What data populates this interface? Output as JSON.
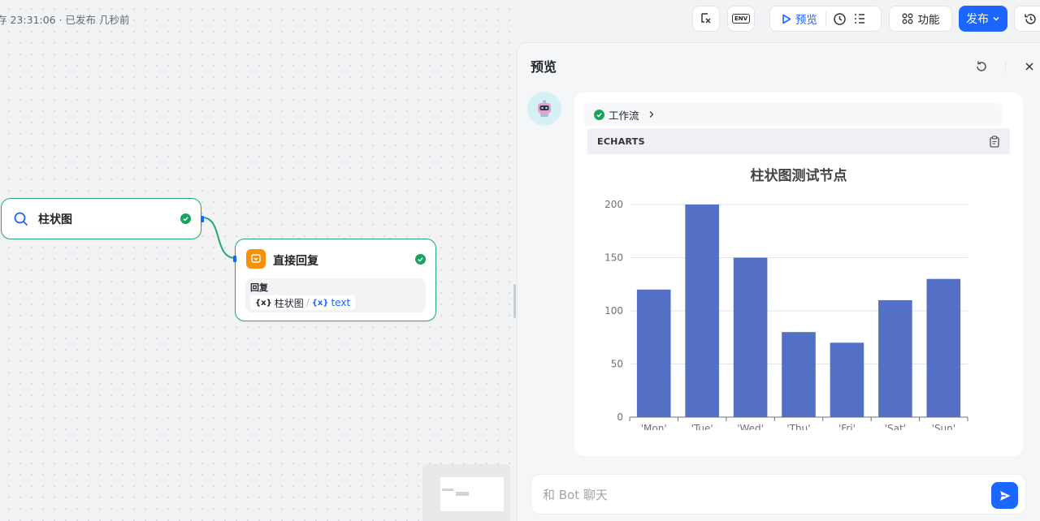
{
  "header": {
    "save_status": "存 23:31:06 · 已发布 几秒前"
  },
  "toolbar": {
    "preview_label": "预览",
    "features_label": "功能",
    "publish_label": "发布",
    "env_label": "ENV"
  },
  "nodes": {
    "start": {
      "title": "柱状图"
    },
    "reply": {
      "title": "直接回复",
      "field_label": "回复",
      "var_symbol": "{x}",
      "var_node": "柱状图",
      "var_sep": "/",
      "var_name": "text"
    }
  },
  "panel": {
    "title": "预览",
    "workflow_tag": "工作流",
    "code_lang": "ECHARTS"
  },
  "chat": {
    "placeholder": "和 Bot 聊天"
  },
  "colors": {
    "accent": "#1a66ff",
    "success": "#17a35e",
    "node_border": "#2aa76e",
    "bar": "#5470c6"
  },
  "chart_data": {
    "type": "bar",
    "title": "柱状图测试节点",
    "categories": [
      "'Mon'",
      "'Tue'",
      "'Wed'",
      "'Thu'",
      "'Fri'",
      "'Sat'",
      "'Sun'"
    ],
    "values": [
      120,
      200,
      150,
      80,
      70,
      110,
      130
    ],
    "yticks": [
      "0",
      "50",
      "100",
      "150",
      "200"
    ],
    "ylim": [
      0,
      200
    ],
    "grid": true,
    "xlabel": "",
    "ylabel": ""
  }
}
